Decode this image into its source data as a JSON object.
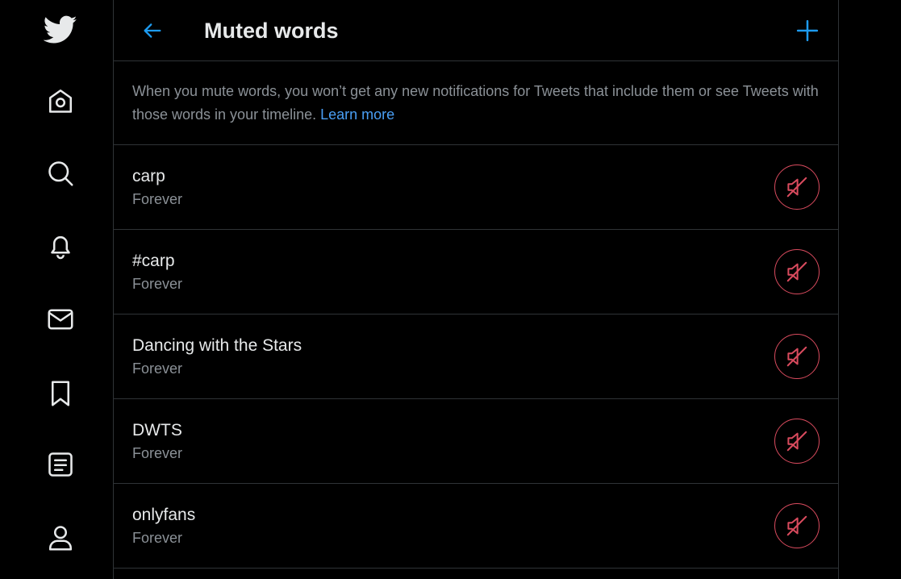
{
  "nav": {
    "items": [
      {
        "icon": "twitter-logo-icon"
      },
      {
        "icon": "home-icon"
      },
      {
        "icon": "search-icon"
      },
      {
        "icon": "notifications-bell-icon"
      },
      {
        "icon": "messages-envelope-icon"
      },
      {
        "icon": "bookmark-icon"
      },
      {
        "icon": "lists-icon"
      },
      {
        "icon": "profile-icon"
      }
    ]
  },
  "header": {
    "title": "Muted words",
    "back_icon": "back-arrow-icon",
    "add_icon": "plus-icon"
  },
  "description": {
    "text": "When you mute words, you won’t get any new notifications for Tweets that include them or see Tweets with those words in your timeline.",
    "link_label": "Learn more"
  },
  "muted_words": [
    {
      "word": "carp",
      "duration": "Forever"
    },
    {
      "word": "#carp",
      "duration": "Forever"
    },
    {
      "word": "Dancing with the Stars",
      "duration": "Forever"
    },
    {
      "word": "DWTS",
      "duration": "Forever"
    },
    {
      "word": "onlyfans",
      "duration": "Forever"
    }
  ],
  "colors": {
    "background": "#000000",
    "accent": "#1d9bf0",
    "danger": "#d94b5e",
    "text_primary": "#e7e9ea",
    "text_secondary": "#8b9197",
    "divider": "#2f3336"
  }
}
